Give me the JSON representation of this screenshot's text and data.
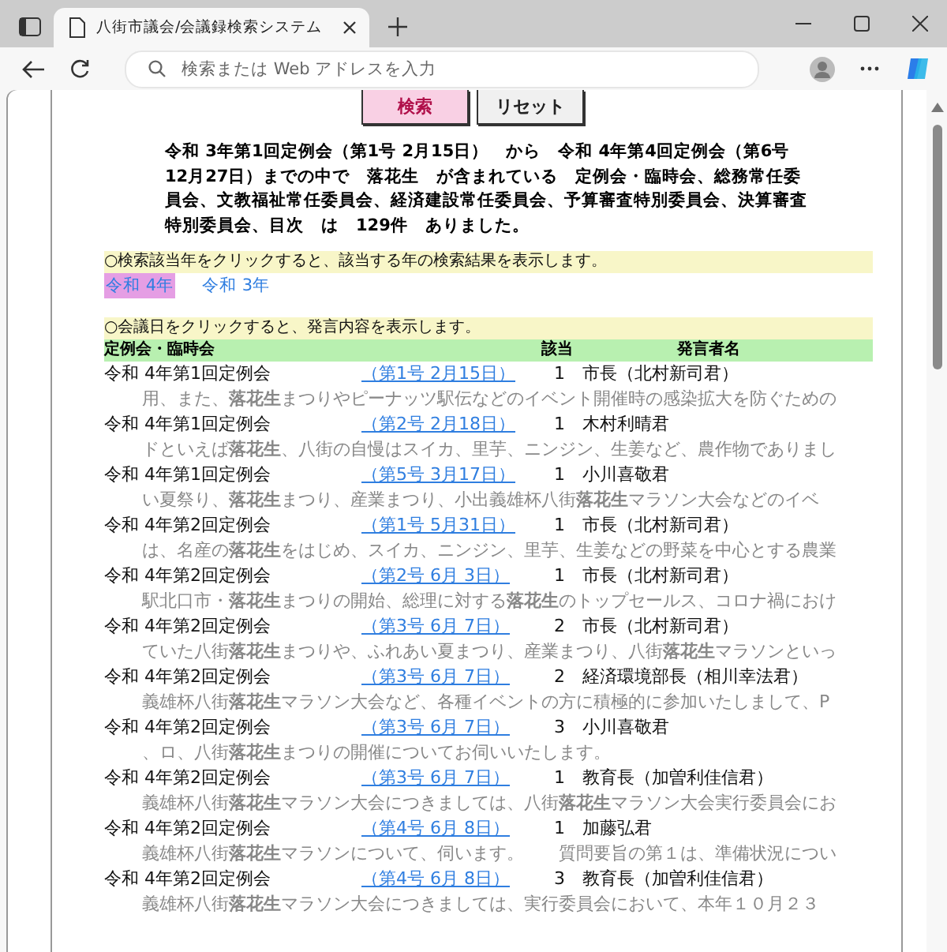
{
  "browser": {
    "tab_title": "八街市議会/会議録検索システム",
    "address_placeholder": "検索または Web アドレスを入力"
  },
  "buttons": [
    {
      "label": "検索",
      "kind": "primary"
    },
    {
      "label": "リセット",
      "kind": "secondary"
    }
  ],
  "summary": "令和 3年第1回定例会（第1号 2月15日）　から　令和 4年第4回定例会（第6号12月27日）までの中で　落花生　が含まれている　定例会・臨時会、総務常任委員会、文教福祉常任委員会、経済建設常任委員会、予算審査特別委員会、決算審査特別委員会、目次　は　129件　ありました。",
  "year_notice": "○検索該当年をクリックすると、該当する年の検索結果を表示します。",
  "years": [
    {
      "label": "令和 4年",
      "selected": true
    },
    {
      "label": "令和 3年",
      "selected": false
    }
  ],
  "meeting_notice": "○会議日をクリックすると、発言内容を表示します。",
  "table": {
    "columns": [
      "定例会・臨時会",
      "該当",
      "発言者名"
    ],
    "rows": [
      {
        "session": "令和 4年第1回定例会",
        "link": "（第1号 2月15日）",
        "count": "1",
        "speaker": "市長（北村新司君）",
        "snippet": "用、また、**落花生**まつりやピーナッツ駅伝などのイベント開催時の感染拡大を防ぐための"
      },
      {
        "session": "令和 4年第1回定例会",
        "link": "（第2号 2月18日）",
        "count": "1",
        "speaker": "木村利晴君",
        "snippet": "ドといえば**落花生**、八街の自慢はスイカ、里芋、ニンジン、生姜など、農作物でありまし"
      },
      {
        "session": "令和 4年第1回定例会",
        "link": "（第5号 3月17日）",
        "count": "1",
        "speaker": "小川喜敬君",
        "snippet": "い夏祭り、**落花生**まつり、産業まつり、小出義雄杯八街**落花生**マラソン大会などのイベ"
      },
      {
        "session": "令和 4年第2回定例会",
        "link": "（第1号 5月31日）",
        "count": "1",
        "speaker": "市長（北村新司君）",
        "snippet": "は、名産の**落花生**をはじめ、スイカ、ニンジン、里芋、生姜などの野菜を中心とする農業"
      },
      {
        "session": "令和 4年第2回定例会",
        "link": "（第2号 6月 3日）",
        "count": "1",
        "speaker": "市長（北村新司君）",
        "snippet": "駅北口市・**落花生**まつりの開始、総理に対する**落花生**のトップセールス、コロナ禍におけ"
      },
      {
        "session": "令和 4年第2回定例会",
        "link": "（第3号 6月 7日）",
        "count": "2",
        "speaker": "市長（北村新司君）",
        "snippet": "ていた八街**落花生**まつりや、ふれあい夏まつり、産業まつり、八街**落花生**マラソンといっ"
      },
      {
        "session": "令和 4年第2回定例会",
        "link": "（第3号 6月 7日）",
        "count": "2",
        "speaker": "経済環境部長（相川幸法君）",
        "snippet": "義雄杯八街**落花生**マラソン大会など、各種イベントの方に積極的に参加いたしまして、P"
      },
      {
        "session": "令和 4年第2回定例会",
        "link": "（第3号 6月 7日）",
        "count": "3",
        "speaker": "小川喜敬君",
        "snippet": "、ロ、八街**落花生**まつりの開催についてお伺いいたします。"
      },
      {
        "session": "令和 4年第2回定例会",
        "link": "（第3号 6月 7日）",
        "count": "1",
        "speaker": "教育長（加曽利佳信君）",
        "snippet": "義雄杯八街**落花生**マラソン大会につきましては、八街**落花生**マラソン大会実行委員会にお"
      },
      {
        "session": "令和 4年第2回定例会",
        "link": "（第4号 6月 8日）",
        "count": "1",
        "speaker": "加藤弘君",
        "snippet": "義雄杯八街**落花生**マラソンについて、伺います。　　質問要旨の第１は、準備状況につい"
      },
      {
        "session": "令和 4年第2回定例会",
        "link": "（第4号 6月 8日）",
        "count": "3",
        "speaker": "教育長（加曽利佳信君）",
        "snippet": "義雄杯八街**落花生**マラソン大会につきましては、実行委員会において、本年１０月２３"
      }
    ]
  }
}
